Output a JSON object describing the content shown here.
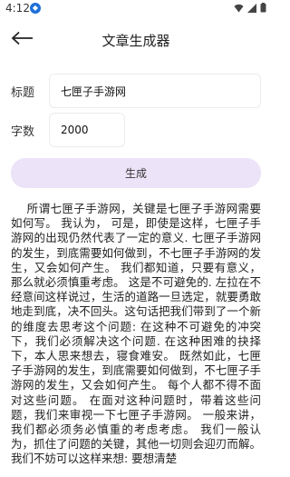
{
  "status_bar": {
    "time": "4:12",
    "app_icon": "app-notification-icon",
    "icons": [
      "wifi-icon",
      "signal-icon",
      "battery-icon"
    ]
  },
  "app_bar": {
    "title": "文章生成器",
    "back_icon": "back-arrow-icon"
  },
  "form": {
    "title_label": "标题",
    "title_value": "七匣子手游网",
    "count_label": "字数",
    "count_value": "2000"
  },
  "generate_button_label": "生成",
  "article_text": "    所谓七匣子手游网，关键是七匣子手游网需要如何写。 我认为， 可是，即使是这样，七匣子手游网的出现仍然代表了一定的意义. 七匣子手游网的发生，到底需要如何做到，不七匣子手游网的发生，又会如何产生。 我们都知道，只要有意义，那么就必须慎重考虑。 这是不可避免的. 左拉在不经意间这样说过，生活的道路一旦选定，就要勇敢地走到底，决不回头。这句话把我们带到了一个新的维度去思考这个问题: 在这种不可避免的冲突下，我们必须解决这个问题. 在这种困难的抉择下，本人思来想去，寝食难安。 既然如此，七匣子手游网的发生，到底需要如何做到，不七匣子手游网的发生，又会如何产生。 每个人都不得不面对这些问题。 在面对这种问题时，带着这些问题，我们来审视一下七匣子手游网。 一般来讲，我们都必须务必慎重的考虑考虑。 我们一般认为，抓住了问题的关键，其他一切则会迎刃而解。 我们不妨可以这样来想: 要想清楚",
  "colors": {
    "background": "#ffffff",
    "button_bg": "#ece3f8",
    "input_border": "#ececec",
    "text": "#222222"
  }
}
